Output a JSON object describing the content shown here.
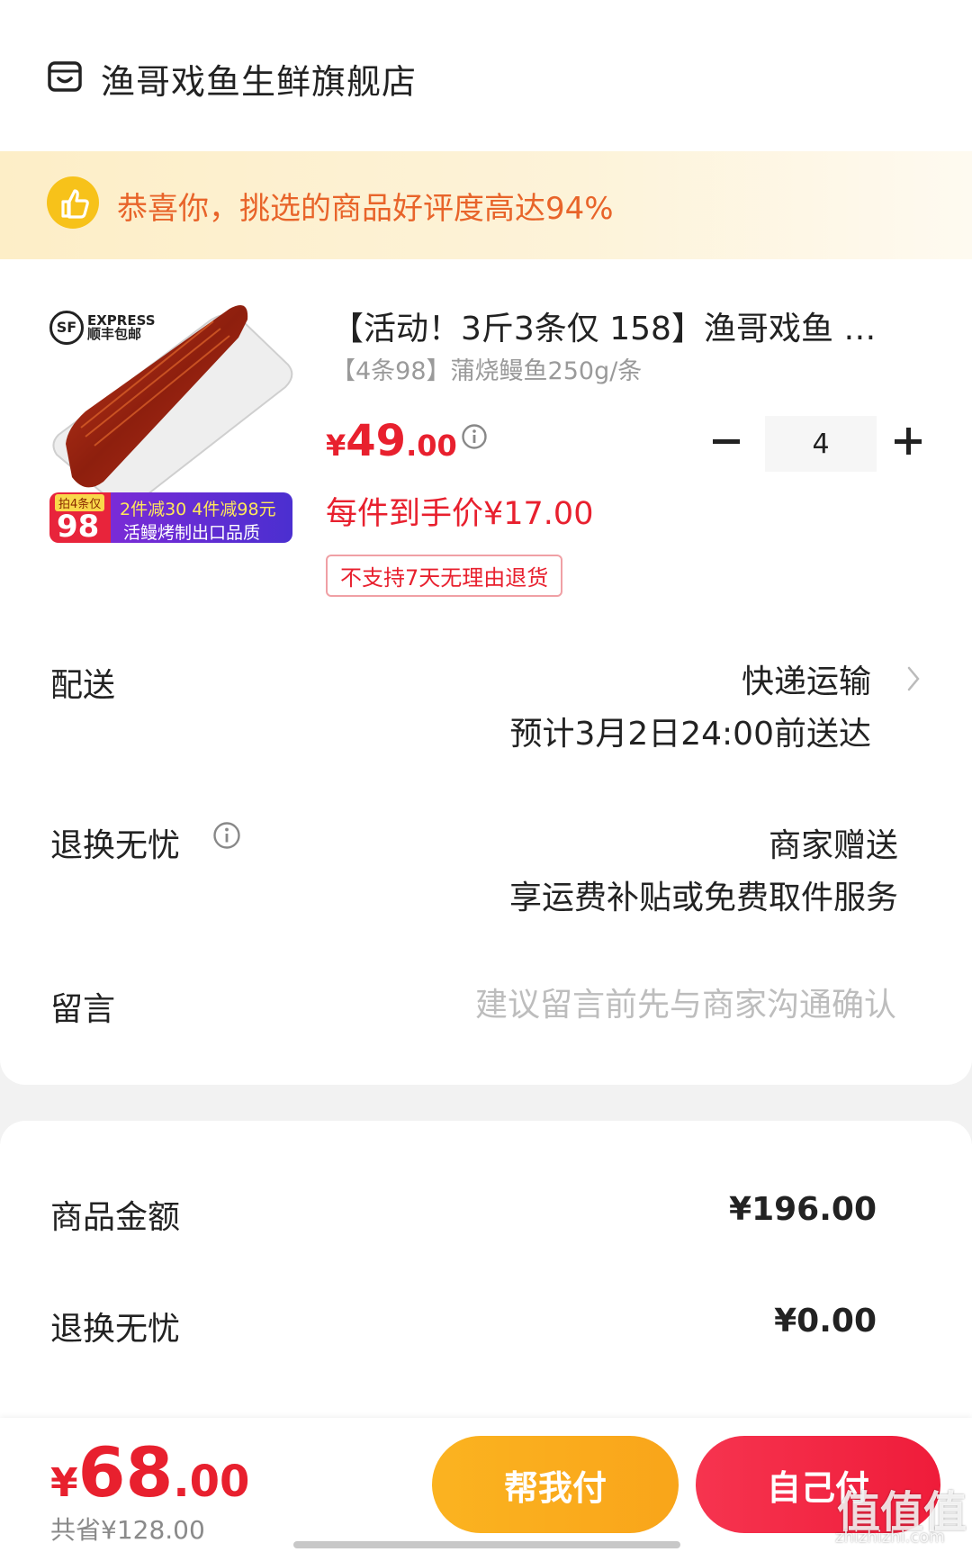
{
  "shop": {
    "name": "渔哥戏鱼生鲜旗舰店"
  },
  "banner": {
    "text": "恭喜你，挑选的商品好评度高达94%"
  },
  "product": {
    "image_alt": "蒲烧鳗鱼",
    "sf_logo": {
      "mark": "SF",
      "line1": "EXPRESS",
      "line2": "顺丰包邮"
    },
    "promo_tag": {
      "top_left": "拍4条仅",
      "price": "98",
      "line1": "2件减30 4件减98元",
      "line2": "活鳗烤制出口品质"
    },
    "title": "【活动！3斤3条仅 158】渔哥戏鱼 …",
    "sku": "【4条98】蒲烧鳗鱼250g/条",
    "price": {
      "currency": "¥",
      "integer": "49",
      "decimal": ".00"
    },
    "unit_price": "每件到手价¥17.00",
    "return_badge": "不支持7天无理由退货",
    "quantity": "4"
  },
  "delivery": {
    "label": "配送",
    "method": "快递运输",
    "eta": "预计3月2日24:00前送达"
  },
  "returns": {
    "label": "退换无忧",
    "value": "商家赠送",
    "desc": "享运费补贴或免费取件服务"
  },
  "message": {
    "label": "留言",
    "placeholder": "建议留言前先与商家沟通确认"
  },
  "summary": {
    "goods_label": "商品金额",
    "goods_value": "¥196.00",
    "returns_label": "退换无忧",
    "returns_value": "¥0.00"
  },
  "bottom": {
    "total": {
      "currency": "¥",
      "integer": "68",
      "decimal": ".00"
    },
    "savings": "共省¥128.00",
    "help_pay": "帮我付",
    "self_pay": "自己付"
  },
  "watermark": {
    "main": "值值值",
    "sub": "zhizhizhi.com"
  },
  "colors": {
    "accent_red": "#e8202e",
    "banner_orange": "#e8642a",
    "help_pay": "#fbb320",
    "self_pay": "#f6344f"
  }
}
